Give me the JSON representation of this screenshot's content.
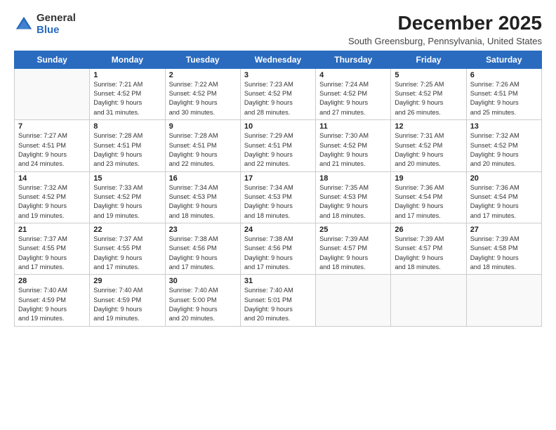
{
  "logo": {
    "general": "General",
    "blue": "Blue"
  },
  "title": "December 2025",
  "subtitle": "South Greensburg, Pennsylvania, United States",
  "weekdays": [
    "Sunday",
    "Monday",
    "Tuesday",
    "Wednesday",
    "Thursday",
    "Friday",
    "Saturday"
  ],
  "weeks": [
    [
      {
        "day": "",
        "info": ""
      },
      {
        "day": "1",
        "info": "Sunrise: 7:21 AM\nSunset: 4:52 PM\nDaylight: 9 hours\nand 31 minutes."
      },
      {
        "day": "2",
        "info": "Sunrise: 7:22 AM\nSunset: 4:52 PM\nDaylight: 9 hours\nand 30 minutes."
      },
      {
        "day": "3",
        "info": "Sunrise: 7:23 AM\nSunset: 4:52 PM\nDaylight: 9 hours\nand 28 minutes."
      },
      {
        "day": "4",
        "info": "Sunrise: 7:24 AM\nSunset: 4:52 PM\nDaylight: 9 hours\nand 27 minutes."
      },
      {
        "day": "5",
        "info": "Sunrise: 7:25 AM\nSunset: 4:52 PM\nDaylight: 9 hours\nand 26 minutes."
      },
      {
        "day": "6",
        "info": "Sunrise: 7:26 AM\nSunset: 4:51 PM\nDaylight: 9 hours\nand 25 minutes."
      }
    ],
    [
      {
        "day": "7",
        "info": "Sunrise: 7:27 AM\nSunset: 4:51 PM\nDaylight: 9 hours\nand 24 minutes."
      },
      {
        "day": "8",
        "info": "Sunrise: 7:28 AM\nSunset: 4:51 PM\nDaylight: 9 hours\nand 23 minutes."
      },
      {
        "day": "9",
        "info": "Sunrise: 7:28 AM\nSunset: 4:51 PM\nDaylight: 9 hours\nand 22 minutes."
      },
      {
        "day": "10",
        "info": "Sunrise: 7:29 AM\nSunset: 4:51 PM\nDaylight: 9 hours\nand 22 minutes."
      },
      {
        "day": "11",
        "info": "Sunrise: 7:30 AM\nSunset: 4:52 PM\nDaylight: 9 hours\nand 21 minutes."
      },
      {
        "day": "12",
        "info": "Sunrise: 7:31 AM\nSunset: 4:52 PM\nDaylight: 9 hours\nand 20 minutes."
      },
      {
        "day": "13",
        "info": "Sunrise: 7:32 AM\nSunset: 4:52 PM\nDaylight: 9 hours\nand 20 minutes."
      }
    ],
    [
      {
        "day": "14",
        "info": "Sunrise: 7:32 AM\nSunset: 4:52 PM\nDaylight: 9 hours\nand 19 minutes."
      },
      {
        "day": "15",
        "info": "Sunrise: 7:33 AM\nSunset: 4:52 PM\nDaylight: 9 hours\nand 19 minutes."
      },
      {
        "day": "16",
        "info": "Sunrise: 7:34 AM\nSunset: 4:53 PM\nDaylight: 9 hours\nand 18 minutes."
      },
      {
        "day": "17",
        "info": "Sunrise: 7:34 AM\nSunset: 4:53 PM\nDaylight: 9 hours\nand 18 minutes."
      },
      {
        "day": "18",
        "info": "Sunrise: 7:35 AM\nSunset: 4:53 PM\nDaylight: 9 hours\nand 18 minutes."
      },
      {
        "day": "19",
        "info": "Sunrise: 7:36 AM\nSunset: 4:54 PM\nDaylight: 9 hours\nand 17 minutes."
      },
      {
        "day": "20",
        "info": "Sunrise: 7:36 AM\nSunset: 4:54 PM\nDaylight: 9 hours\nand 17 minutes."
      }
    ],
    [
      {
        "day": "21",
        "info": "Sunrise: 7:37 AM\nSunset: 4:55 PM\nDaylight: 9 hours\nand 17 minutes."
      },
      {
        "day": "22",
        "info": "Sunrise: 7:37 AM\nSunset: 4:55 PM\nDaylight: 9 hours\nand 17 minutes."
      },
      {
        "day": "23",
        "info": "Sunrise: 7:38 AM\nSunset: 4:56 PM\nDaylight: 9 hours\nand 17 minutes."
      },
      {
        "day": "24",
        "info": "Sunrise: 7:38 AM\nSunset: 4:56 PM\nDaylight: 9 hours\nand 17 minutes."
      },
      {
        "day": "25",
        "info": "Sunrise: 7:39 AM\nSunset: 4:57 PM\nDaylight: 9 hours\nand 18 minutes."
      },
      {
        "day": "26",
        "info": "Sunrise: 7:39 AM\nSunset: 4:57 PM\nDaylight: 9 hours\nand 18 minutes."
      },
      {
        "day": "27",
        "info": "Sunrise: 7:39 AM\nSunset: 4:58 PM\nDaylight: 9 hours\nand 18 minutes."
      }
    ],
    [
      {
        "day": "28",
        "info": "Sunrise: 7:40 AM\nSunset: 4:59 PM\nDaylight: 9 hours\nand 19 minutes."
      },
      {
        "day": "29",
        "info": "Sunrise: 7:40 AM\nSunset: 4:59 PM\nDaylight: 9 hours\nand 19 minutes."
      },
      {
        "day": "30",
        "info": "Sunrise: 7:40 AM\nSunset: 5:00 PM\nDaylight: 9 hours\nand 20 minutes."
      },
      {
        "day": "31",
        "info": "Sunrise: 7:40 AM\nSunset: 5:01 PM\nDaylight: 9 hours\nand 20 minutes."
      },
      {
        "day": "",
        "info": ""
      },
      {
        "day": "",
        "info": ""
      },
      {
        "day": "",
        "info": ""
      }
    ]
  ]
}
